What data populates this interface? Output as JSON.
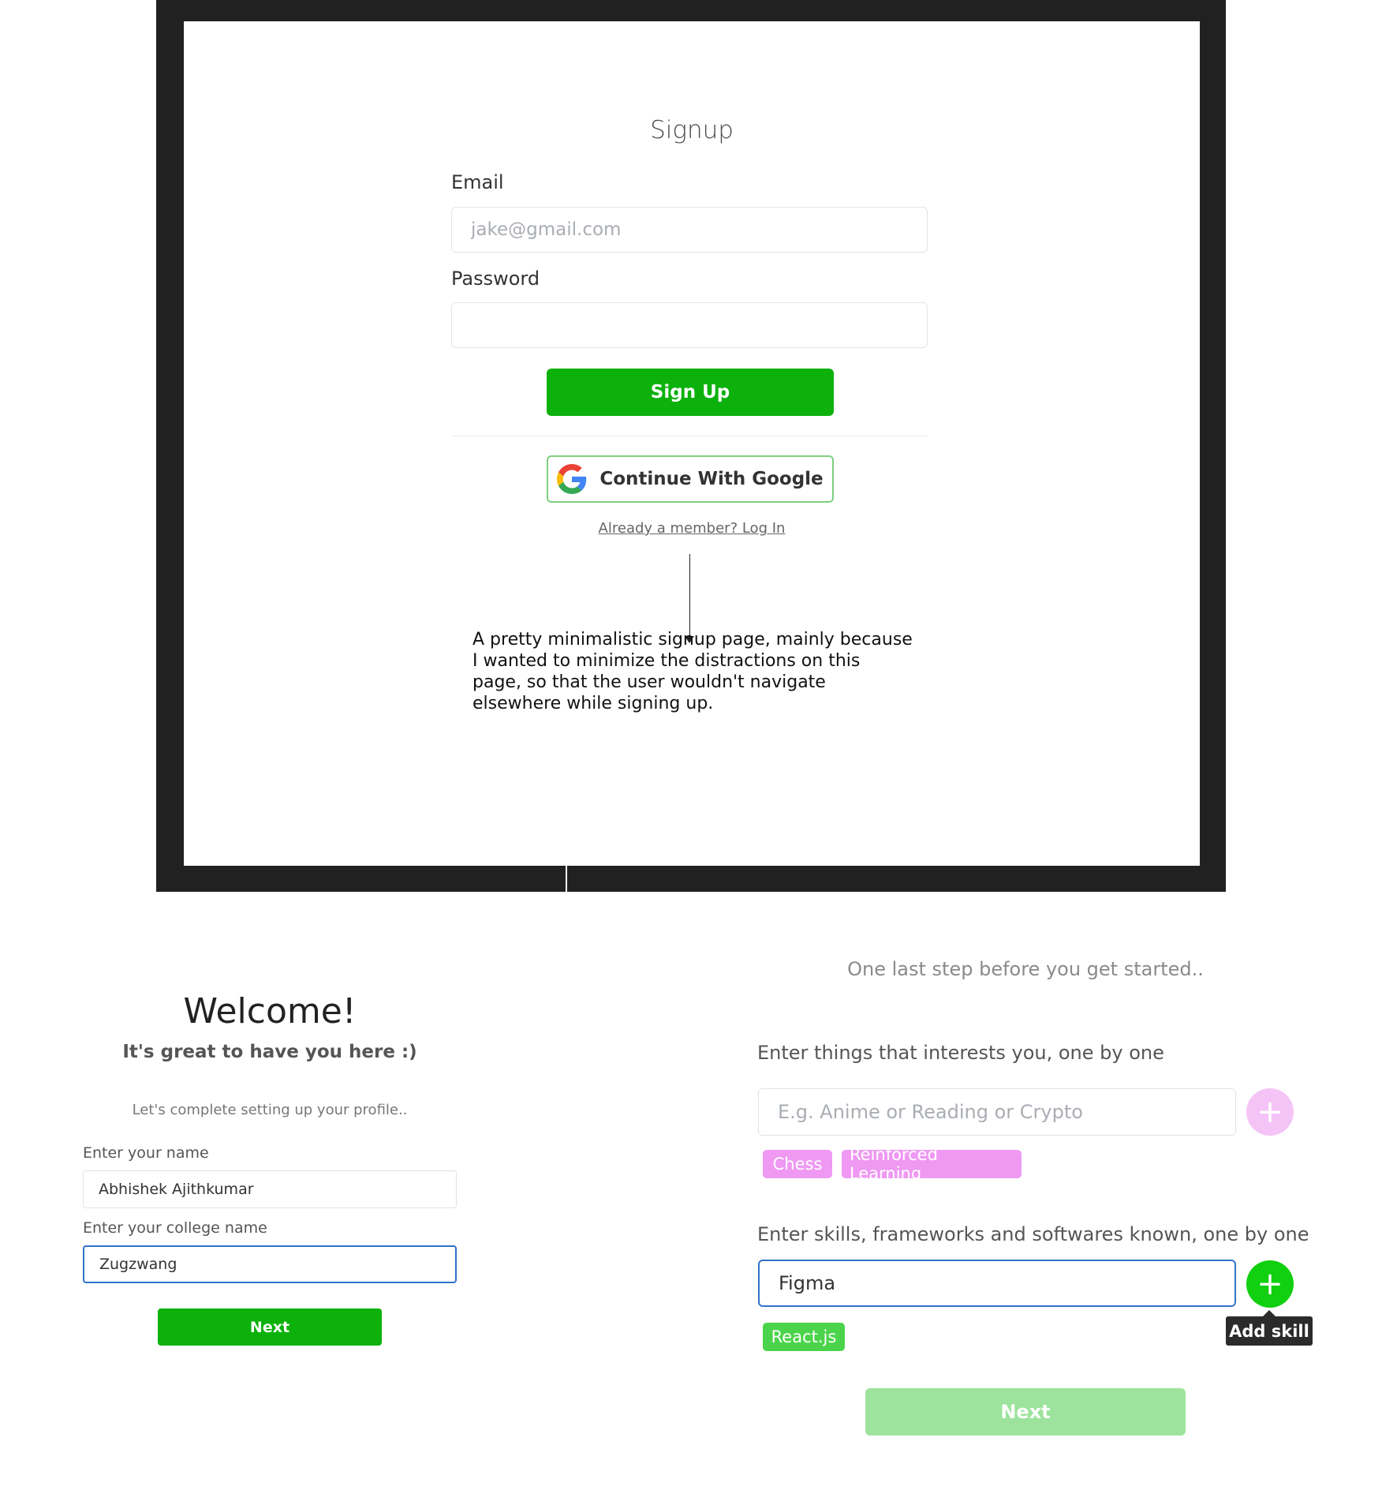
{
  "signup": {
    "title": "Signup",
    "email_label": "Email",
    "email_placeholder": "jake@gmail.com",
    "password_label": "Password",
    "signup_button": "Sign Up",
    "google_button": "Continue With Google",
    "login_link": "Already a member? Log In",
    "annotation": "A pretty minimalistic signup page, mainly because I wanted to minimize the distractions on this page, so that the user wouldn't navigate elsewhere while signing up."
  },
  "welcome": {
    "title": "Welcome!",
    "subtitle": "It's great to have you here :)",
    "hint": "Let's complete setting up your profile..",
    "name_label": "Enter your name",
    "name_value": "Abhishek Ajithkumar",
    "college_label": "Enter your college name",
    "college_value": "Zugzwang",
    "next_button": "Next"
  },
  "profile": {
    "heading": "One last step before you get started..",
    "interests_label": "Enter things that interests you, one by one",
    "interests_placeholder": "E.g. Anime or Reading or Crypto",
    "interest_tags": [
      "Chess",
      "Reinforced Learning"
    ],
    "skills_label": "Enter skills, frameworks and softwares known, one by one",
    "skills_value": "Figma",
    "skill_tags": [
      "React.js"
    ],
    "add_skill_tooltip": "Add skill",
    "next_button": "Next"
  },
  "colors": {
    "primary_green": "#0cb10c",
    "pink_tag": "#ef99f3",
    "green_tag": "#4bd44b",
    "focus_blue": "#3173c9",
    "frame_dark": "#212121"
  },
  "icons": {
    "google": "google-g-icon",
    "add_interest": "plus-icon",
    "add_skill": "plus-icon"
  }
}
